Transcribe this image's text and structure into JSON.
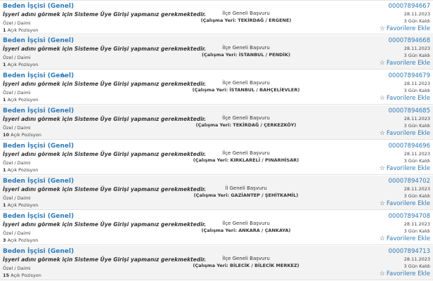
{
  "listings": [
    {
      "title": "Beden İşçisi (Genel)",
      "has_disabled_icon": false,
      "warning": "İşyeri adını görmek için Sisteme Üye Girişi yapmanız gerekmektedir.",
      "type": "Özel / Daimi",
      "position_count": "1",
      "position_label": "Açık Pozisyon",
      "scope": "İlçe Geneli Başvuru",
      "location": "(Çalışma Yeri: TEKİRDAĞ / ERGENE)",
      "id": "00007894667",
      "date": "28.11.2023",
      "days_left": "3 Gün Kaldı",
      "favorite_label": "Favorilere Ekle"
    },
    {
      "title": "Beden İşçisi (Genel)",
      "has_disabled_icon": false,
      "warning": "İşyeri adını görmek için Sisteme Üye Girişi yapmanız gerekmektedir.",
      "type": "Özel / Daimi",
      "position_count": "1",
      "position_label": "Açık Pozisyon",
      "scope": "İlçe Geneli Başvuru",
      "location": "(Çalışma Yeri: İSTANBUL / PENDİK)",
      "id": "00007894668",
      "date": "28.11.2023",
      "days_left": "3 Gün Kaldı",
      "favorite_label": "Favorilere Ekle"
    },
    {
      "title": "Beden İşçisi (Genel)",
      "has_disabled_icon": true,
      "warning": "İşyeri adını görmek için Sisteme Üye Girişi yapmanız gerekmektedir.",
      "type": "Özel / Daimi",
      "position_count": "1",
      "position_label": "Açık Pozisyon",
      "scope": "İlçe Geneli Başvuru",
      "location": "(Çalışma Yeri: İSTANBUL / BAHÇELİEVLER)",
      "id": "00007894679",
      "date": "28.11.2023",
      "days_left": "3 Gün Kaldı",
      "favorite_label": "Favorilere Ekle"
    },
    {
      "title": "Beden İşçisi (Genel)",
      "has_disabled_icon": false,
      "warning": "İşyeri adını görmek için Sisteme Üye Girişi yapmanız gerekmektedir.",
      "type": "Özel / Daimi",
      "position_count": "10",
      "position_label": "Açık Pozisyon",
      "scope": "İlçe Geneli Başvuru",
      "location": "(Çalışma Yeri: TEKİRDAĞ / ÇERKEZKÖY)",
      "id": "00007894685",
      "date": "28.11.2023",
      "days_left": "3 Gün Kaldı",
      "favorite_label": "Favorilere Ekle"
    },
    {
      "title": "Beden İşçisi (Genel)",
      "has_disabled_icon": false,
      "warning": "İşyeri adını görmek için Sisteme Üye Girişi yapmanız gerekmektedir.",
      "type": "Özel / Daimi",
      "position_count": "1",
      "position_label": "Açık Pozisyon",
      "scope": "İlçe Geneli Başvuru",
      "location": "(Çalışma Yeri: KIRKLARELİ / PINARHİSAR)",
      "id": "00007894696",
      "date": "28.11.2023",
      "days_left": "3 Gün Kaldı",
      "favorite_label": "Favorilere Ekle"
    },
    {
      "title": "Beden İşçisi (Genel)",
      "has_disabled_icon": false,
      "warning": "İşyeri adını görmek için Sisteme Üye Girişi yapmanız gerekmektedir.",
      "type": "Özel / Daimi",
      "position_count": "1",
      "position_label": "Açık Pozisyon",
      "scope": "İl Geneli Başvuru",
      "location": "(Çalışma Yeri: GAZİANTEP / ŞEHİTKAMİL)",
      "id": "00007894702",
      "date": "28.11.2023",
      "days_left": "3 Gün Kaldı",
      "favorite_label": "Favorilere Ekle"
    },
    {
      "title": "Beden İşçisi (Genel)",
      "has_disabled_icon": false,
      "warning": "İşyeri adını görmek için Sisteme Üye Girişi yapmanız gerekmektedir.",
      "type": "Özel / Daimi",
      "position_count": "3",
      "position_label": "Açık Pozisyon",
      "scope": "İlçe Geneli Başvuru",
      "location": "(Çalışma Yeri: ANKARA / ÇANKAYA)",
      "id": "00007894708",
      "date": "28.11.2023",
      "days_left": "3 Gün Kaldı",
      "favorite_label": "Favorilere Ekle"
    },
    {
      "title": "Beden İşçisi (Genel)",
      "has_disabled_icon": false,
      "warning": "İşyeri adını görmek için Sisteme Üye Girişi yapmanız gerekmektedir.",
      "type": "Özel / Daimi",
      "position_count": "15",
      "position_label": "Açık Pozisyon",
      "scope": "İlçe Geneli Başvuru",
      "location": "(Çalışma Yeri: BİLECİK / BİLECİK MERKEZ)",
      "id": "00007894713",
      "date": "28.11.2023",
      "days_left": "3 Gün Kaldı",
      "favorite_label": "Favorilere Ekle"
    }
  ],
  "icons": {
    "favorite": "star-outline-icon",
    "accessibility": "wheelchair-icon"
  },
  "colors": {
    "link": "#2e7ab8",
    "row_alt": "#f3f3f3",
    "divider": "#e3e3e3"
  }
}
